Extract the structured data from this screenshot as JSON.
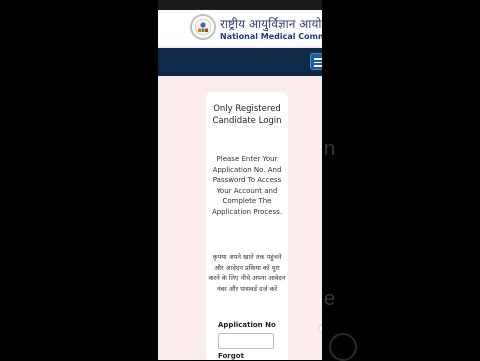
{
  "header": {
    "hindi_title": "राष्ट्रीय आयुर्विज्ञान आयो",
    "english_title": "National Medical Commissio",
    "logo_icon": "nmc-emblem-icon",
    "menu_icon": "hamburger-menu-icon"
  },
  "login_card": {
    "title": "Only Registered Candidate Login",
    "description": "Please Enter Your Application No. And Password To Access Your Account and Complete The Application Process.",
    "hindi_description": "कृपया अपने खाते तक पहुंचने और आवेदन प्रकिया को पूरा करने के लिए नीचे अपना आवेदन नंबर और पासवर्ड दर्ज करें",
    "application_no_label": "Application No",
    "application_no_value": "",
    "forgot_label": "Forgot"
  },
  "background_ghost_text": [
    "n",
    "e"
  ],
  "colors": {
    "navbar": "#0e2a47",
    "page_bg": "#fbecec",
    "brand_blue": "#1b3b8f"
  }
}
